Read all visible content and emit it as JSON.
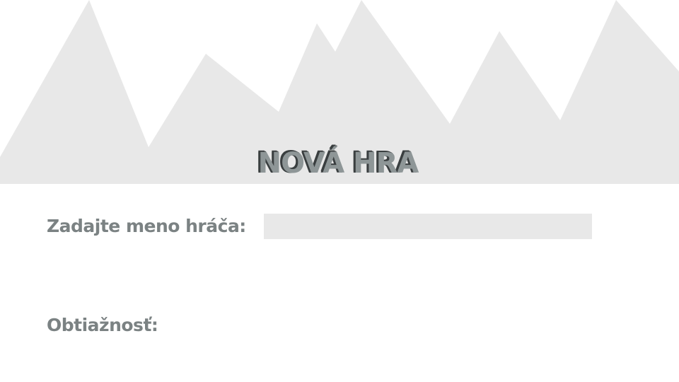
{
  "screen": {
    "title": "NOVÁ HRA",
    "player_name_label": "Zadajte meno hráča:",
    "player_name_value": "",
    "difficulty_label": "Obtiažnosť:"
  },
  "colors": {
    "background": "#ffffff",
    "mountains": "#e8e8e8",
    "label_text": "#7b8283",
    "title_fill": "#8e9697",
    "title_shadow": "#3a3f40",
    "input_background": "#e8e8e8"
  },
  "icons": {
    "background_art": "mountain-range"
  }
}
